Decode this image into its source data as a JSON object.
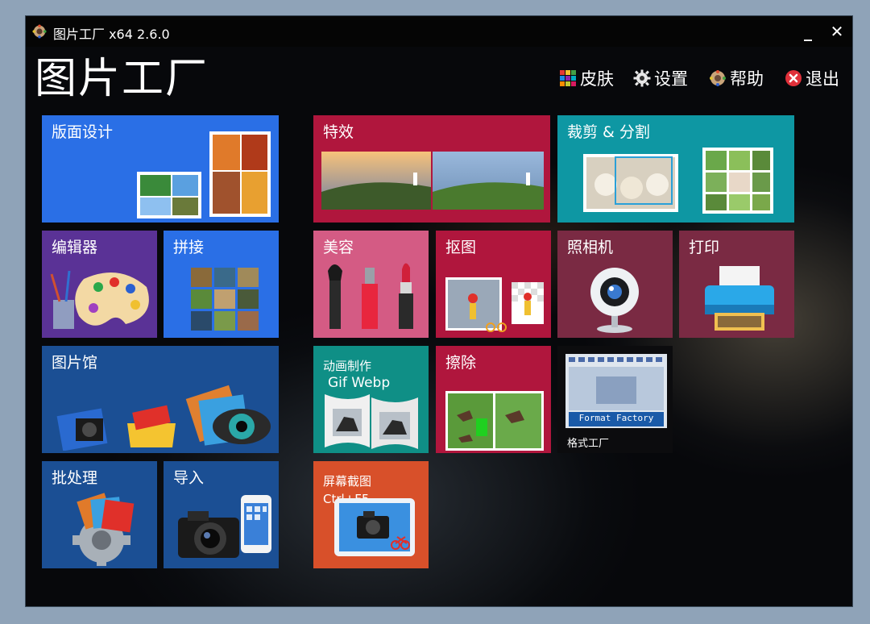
{
  "window": {
    "title": "图片工厂 x64 2.6.0",
    "minimize_glyph": "_",
    "close_glyph": "✕"
  },
  "brand": "图片工厂",
  "menu": {
    "skin": "皮肤",
    "settings": "设置",
    "help": "帮助",
    "exit": "退出"
  },
  "tiles": {
    "layout_design": "版面设计",
    "effects": "特效",
    "crop_split": "裁剪 & 分割",
    "editor": "编辑器",
    "stitch": "拼接",
    "beauty": "美容",
    "cutout": "抠图",
    "camera": "照相机",
    "print": "打印",
    "gallery": "图片馆",
    "animation": "动画制作",
    "animation_sub": "Gif Webp",
    "erase": "擦除",
    "format_factory": "格式工厂",
    "format_factory_logo": "Format Factory",
    "batch": "批处理",
    "import": "导入",
    "screenshot": "屏幕截图",
    "screenshot_hotkey": "Ctrl+F5"
  },
  "colors": {
    "blue": "#2a6fe6",
    "navy": "#1b4f94",
    "crimson": "#b0163d",
    "teal": "#0e97a3",
    "purple": "#5a3296",
    "pink": "#d45b84",
    "maroon": "#7a2a43",
    "green_teal": "#0f8f86",
    "orange": "#d8502a"
  }
}
